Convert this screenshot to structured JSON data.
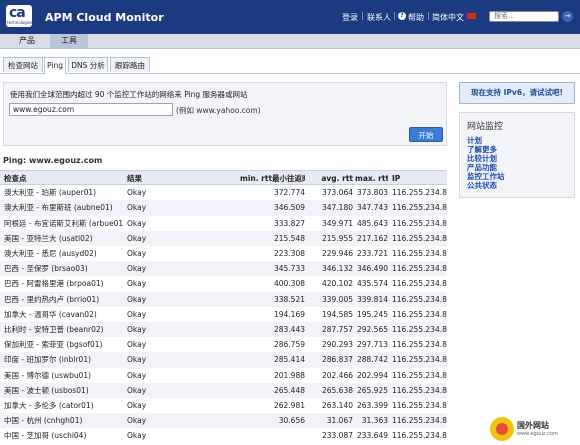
{
  "header": {
    "logo": "ca",
    "logo_sub": "technologies",
    "title": "APM Cloud Monitor",
    "links": [
      "登录",
      "联系人",
      "帮助",
      "简体中文"
    ],
    "help_icon": "help-circle-icon",
    "search_placeholder": "搜索...",
    "search_go": "→"
  },
  "nav": {
    "tabs": [
      "产品",
      "工具"
    ]
  },
  "subtabs": [
    "检查网站",
    "Ping",
    "DNS 分析",
    "跟踪路由"
  ],
  "form": {
    "description": "使用我们全球范围内超过 90 个监控工作站的网络来 Ping 服务器或网站",
    "url_value": "www.egouz.com",
    "example": "(例如 www.yahoo.com)",
    "start_label": "开始"
  },
  "results": {
    "title": "Ping: www.egouz.com",
    "columns": [
      "检查点",
      "结果",
      "min. rtt最小往返时间",
      "avg. rtt",
      "max. rtt",
      "IP"
    ],
    "rows": [
      [
        "澳大利亚 - 珀斯 (auper01)",
        "Okay",
        "372.774",
        "373.064",
        "373.803",
        "116.255.234.80"
      ],
      [
        "澳大利亚 - 布里斯班 (aubne01)",
        "Okay",
        "346.509",
        "347.180",
        "347.743",
        "116.255.234.80"
      ],
      [
        "阿根廷 - 布宜诺斯艾利斯 (arbue01)",
        "Okay",
        "333.827",
        "349.971",
        "485.643",
        "116.255.234.80"
      ],
      [
        "美国 - 亚特兰大 (usatl02)",
        "Okay",
        "215.548",
        "215.955",
        "217.162",
        "116.255.234.80"
      ],
      [
        "澳大利亚 - 悉尼 (ausyd02)",
        "Okay",
        "223.308",
        "229.946",
        "233.721",
        "116.255.234.80"
      ],
      [
        "巴西 - 圣保罗 (brsao03)",
        "Okay",
        "345.733",
        "346.132",
        "346.490",
        "116.255.234.80"
      ],
      [
        "巴西 - 阿雷格里港 (brpoa01)",
        "Okay",
        "400.308",
        "420.102",
        "435.574",
        "116.255.234.80"
      ],
      [
        "巴西 - 里约热内卢 (brrio01)",
        "Okay",
        "338.521",
        "339.005",
        "339.814",
        "116.255.234.80"
      ],
      [
        "加拿大 - 温哥华 (cavan02)",
        "Okay",
        "194.169",
        "194.585",
        "195.245",
        "116.255.234.80"
      ],
      [
        "比利时 - 安特卫普 (beanr02)",
        "Okay",
        "283.443",
        "287.757",
        "292.565",
        "116.255.234.80"
      ],
      [
        "保加利亚 - 索菲亚 (bgsof01)",
        "Okay",
        "286.759",
        "290.293",
        "297.713",
        "116.255.234.80"
      ],
      [
        "印度 - 班加罗尔 (inblr01)",
        "Okay",
        "285.414",
        "286.837",
        "288.742",
        "116.255.234.80"
      ],
      [
        "美国 - 博尔德 (uswbu01)",
        "Okay",
        "201.988",
        "202.466",
        "202.994",
        "116.255.234.80"
      ],
      [
        "美国 - 波士顿 (usbos01)",
        "Okay",
        "265.448",
        "265.638",
        "265.925",
        "116.255.234.80"
      ],
      [
        "加拿大 - 多伦多 (cator01)",
        "Okay",
        "262.981",
        "263.140",
        "263.399",
        "116.255.234.80"
      ],
      [
        "中国 - 杭州 (cnhgh01)",
        "Okay",
        "30.656",
        "31.067",
        "31.363",
        "116.255.234.80"
      ],
      [
        "中国 - 芝加哥 (uschi04)",
        "Okay",
        "",
        "233.087",
        "233.649",
        "116.255.234.80"
      ]
    ]
  },
  "sidebar": {
    "promo": "现在支持 IPv6，请试试吧!",
    "title": "网站监控",
    "links": [
      "计划",
      "了解更多",
      "比较计划",
      "产品功能",
      "监控工作站",
      "公共状态"
    ]
  },
  "watermark": {
    "text": "国外网站",
    "sub": "www.egouz.com"
  },
  "colors": {
    "header_bg": "#1b3a80",
    "accent": "#3a7bd5",
    "link": "#1a4cb0"
  }
}
